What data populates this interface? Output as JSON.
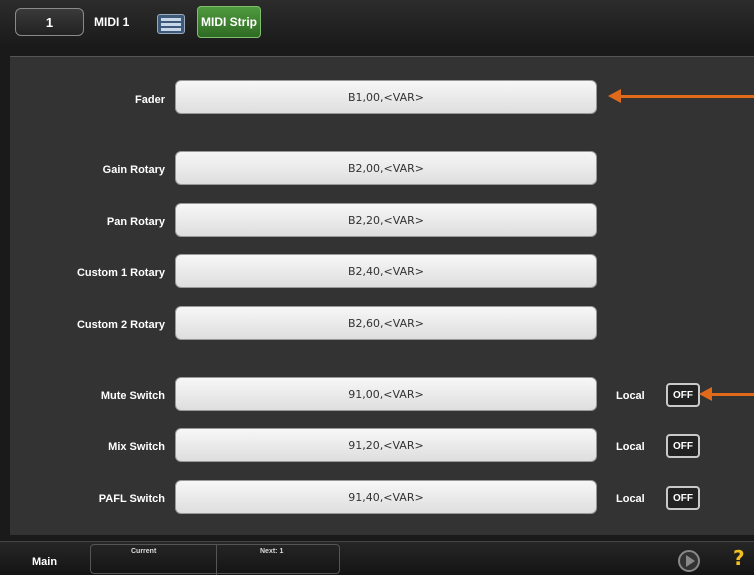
{
  "header": {
    "channel_number": "1",
    "channel_name": "MIDI 1",
    "keyboard_icon": "keyboard-icon",
    "active_tab": "MIDI Strip"
  },
  "rows": [
    {
      "label": "Fader",
      "value": "B1,00,<VAR>"
    },
    {
      "label": "Gain Rotary",
      "value": "B2,00,<VAR>"
    },
    {
      "label": "Pan Rotary",
      "value": "B2,20,<VAR>"
    },
    {
      "label": "Custom 1 Rotary",
      "value": "B2,40,<VAR>"
    },
    {
      "label": "Custom 2 Rotary",
      "value": "B2,60,<VAR>"
    },
    {
      "label": "Mute Switch",
      "value": "91,00,<VAR>",
      "local_label": "Local",
      "local_state": "OFF"
    },
    {
      "label": "Mix Switch",
      "value": "91,20,<VAR>",
      "local_label": "Local",
      "local_state": "OFF"
    },
    {
      "label": "PAFL Switch",
      "value": "91,40,<VAR>",
      "local_label": "Local",
      "local_state": "OFF"
    }
  ],
  "annotations": {
    "arrow_color": "#e06a1a"
  },
  "footer": {
    "main_label": "Main",
    "current_label": "Current",
    "next_label": "Next: 1",
    "play_icon": "play-icon",
    "help_icon": "help-icon",
    "help_glyph": "?"
  },
  "colors": {
    "tab_active": "#3f8a2f",
    "background": "#333334"
  }
}
